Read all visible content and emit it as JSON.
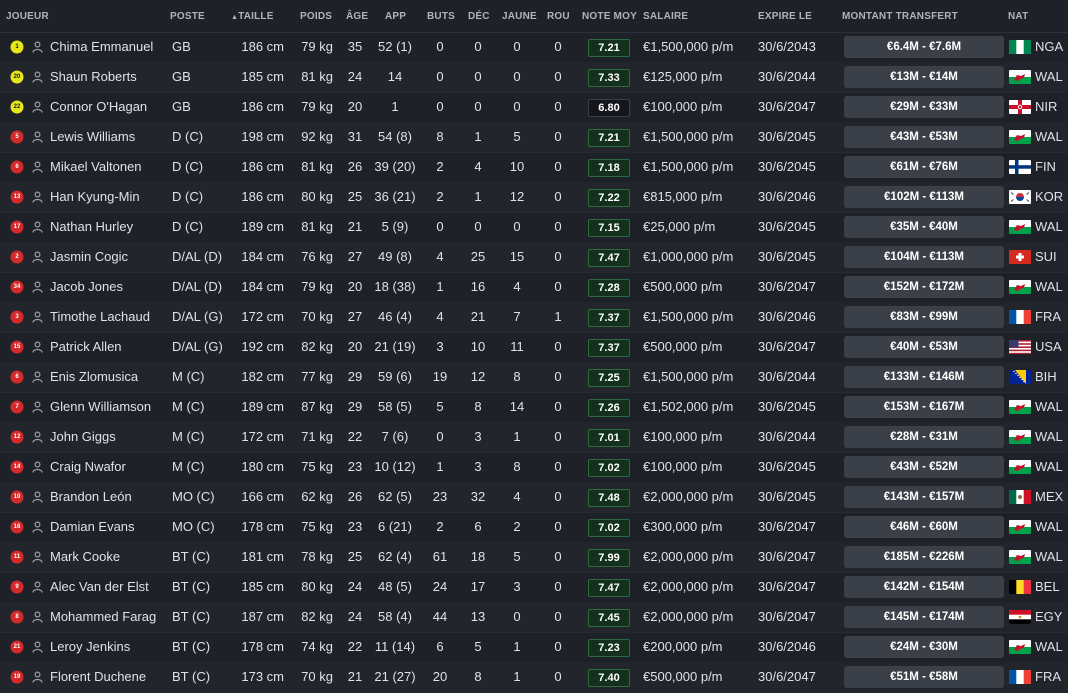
{
  "columns": {
    "player": "JOUEUR",
    "position": "POSTE",
    "height": "TAILLE",
    "weight": "POIDS",
    "age": "ÂGE",
    "apps": "APP",
    "goals": "BUTS",
    "dec": "DÉC",
    "yellow": "JAUNE",
    "red": "ROU",
    "avg_rating": "NOTE MOY",
    "wage": "SALAIRE",
    "expires": "EXPIRE LE",
    "transfer_value": "MONTANT TRANSFERT",
    "nat": "NAT"
  },
  "sort_indicator": "▲",
  "colors": {
    "background": "#1e2128",
    "row_alt": "#22252c",
    "rating_bg": "#12301c",
    "rating_border": "#2e6a3e",
    "value_pill": "#3a3f48",
    "gk_shirt": "#e6e619",
    "outfield_shirt": "#d42a2a"
  },
  "players": [
    {
      "num": "1",
      "shirt": "gk",
      "name": "Chima Emmanuel",
      "pos": "GB",
      "height": "186 cm",
      "weight": "79 kg",
      "age": "35",
      "apps": "52 (1)",
      "goals": "0",
      "dec": "0",
      "yellow": "0",
      "red": "0",
      "rating": "7.21",
      "wage": "€1,500,000 p/m",
      "expires": "30/6/2043",
      "value": "€6.4M - €7.6M",
      "flag": "nga",
      "nat": "NGA"
    },
    {
      "num": "20",
      "shirt": "gk",
      "name": "Shaun Roberts",
      "pos": "GB",
      "height": "185 cm",
      "weight": "81 kg",
      "age": "24",
      "apps": "14",
      "goals": "0",
      "dec": "0",
      "yellow": "0",
      "red": "0",
      "rating": "7.33",
      "wage": "€125,000 p/m",
      "expires": "30/6/2044",
      "value": "€13M - €14M",
      "flag": "wal",
      "nat": "WAL"
    },
    {
      "num": "22",
      "shirt": "gk",
      "name": "Connor O'Hagan",
      "pos": "GB",
      "height": "186 cm",
      "weight": "79 kg",
      "age": "20",
      "apps": "1",
      "goals": "0",
      "dec": "0",
      "yellow": "0",
      "red": "0",
      "rating": "6.80",
      "wage": "€100,000 p/m",
      "expires": "30/6/2047",
      "value": "€29M - €33M",
      "flag": "nir",
      "nat": "NIR"
    },
    {
      "num": "5",
      "shirt": "out",
      "name": "Lewis Williams",
      "pos": "D (C)",
      "height": "198 cm",
      "weight": "92 kg",
      "age": "31",
      "apps": "54 (8)",
      "goals": "8",
      "dec": "1",
      "yellow": "5",
      "red": "0",
      "rating": "7.21",
      "wage": "€1,500,000 p/m",
      "expires": "30/6/2045",
      "value": "€43M - €53M",
      "flag": "wal",
      "nat": "WAL"
    },
    {
      "num": "6",
      "shirt": "out",
      "name": "Mikael Valtonen",
      "pos": "D (C)",
      "height": "186 cm",
      "weight": "81 kg",
      "age": "26",
      "apps": "39 (20)",
      "goals": "2",
      "dec": "4",
      "yellow": "10",
      "red": "0",
      "rating": "7.18",
      "wage": "€1,500,000 p/m",
      "expires": "30/6/2045",
      "value": "€61M - €76M",
      "flag": "fin",
      "nat": "FIN"
    },
    {
      "num": "13",
      "shirt": "out",
      "name": "Han Kyung-Min",
      "pos": "D (C)",
      "height": "186 cm",
      "weight": "80 kg",
      "age": "25",
      "apps": "36 (21)",
      "goals": "2",
      "dec": "1",
      "yellow": "12",
      "red": "0",
      "rating": "7.22",
      "wage": "€815,000 p/m",
      "expires": "30/6/2046",
      "value": "€102M - €113M",
      "flag": "kor",
      "nat": "KOR"
    },
    {
      "num": "17",
      "shirt": "out",
      "name": "Nathan Hurley",
      "pos": "D (C)",
      "height": "189 cm",
      "weight": "81 kg",
      "age": "21",
      "apps": "5 (9)",
      "goals": "0",
      "dec": "0",
      "yellow": "0",
      "red": "0",
      "rating": "7.15",
      "wage": "€25,000 p/m",
      "expires": "30/6/2045",
      "value": "€35M - €40M",
      "flag": "wal",
      "nat": "WAL"
    },
    {
      "num": "2",
      "shirt": "out",
      "name": "Jasmin Cogic",
      "pos": "D/AL (D)",
      "height": "184 cm",
      "weight": "76 kg",
      "age": "27",
      "apps": "49 (8)",
      "goals": "4",
      "dec": "25",
      "yellow": "15",
      "red": "0",
      "rating": "7.47",
      "wage": "€1,000,000 p/m",
      "expires": "30/6/2045",
      "value": "€104M - €113M",
      "flag": "sui",
      "nat": "SUI"
    },
    {
      "num": "34",
      "shirt": "out",
      "name": "Jacob Jones",
      "pos": "D/AL (D)",
      "height": "184 cm",
      "weight": "79 kg",
      "age": "20",
      "apps": "18 (38)",
      "goals": "1",
      "dec": "16",
      "yellow": "4",
      "red": "0",
      "rating": "7.28",
      "wage": "€500,000 p/m",
      "expires": "30/6/2047",
      "value": "€152M - €172M",
      "flag": "wal",
      "nat": "WAL"
    },
    {
      "num": "3",
      "shirt": "out",
      "name": "Timothe Lachaud",
      "pos": "D/AL (G)",
      "height": "172 cm",
      "weight": "70 kg",
      "age": "27",
      "apps": "46 (4)",
      "goals": "4",
      "dec": "21",
      "yellow": "7",
      "red": "1",
      "rating": "7.37",
      "wage": "€1,500,000 p/m",
      "expires": "30/6/2046",
      "value": "€83M - €99M",
      "flag": "fra",
      "nat": "FRA"
    },
    {
      "num": "15",
      "shirt": "out",
      "name": "Patrick Allen",
      "pos": "D/AL (G)",
      "height": "192 cm",
      "weight": "82 kg",
      "age": "20",
      "apps": "21 (19)",
      "goals": "3",
      "dec": "10",
      "yellow": "11",
      "red": "0",
      "rating": "7.37",
      "wage": "€500,000 p/m",
      "expires": "30/6/2047",
      "value": "€40M - €53M",
      "flag": "usa",
      "nat": "USA"
    },
    {
      "num": "6",
      "shirt": "out",
      "name": "Enis Zlomusica",
      "pos": "M (C)",
      "height": "182 cm",
      "weight": "77 kg",
      "age": "29",
      "apps": "59 (6)",
      "goals": "19",
      "dec": "12",
      "yellow": "8",
      "red": "0",
      "rating": "7.25",
      "wage": "€1,500,000 p/m",
      "expires": "30/6/2044",
      "value": "€133M - €146M",
      "flag": "bih",
      "nat": "BIH"
    },
    {
      "num": "7",
      "shirt": "out",
      "name": "Glenn Williamson",
      "pos": "M (C)",
      "height": "189 cm",
      "weight": "87 kg",
      "age": "29",
      "apps": "58 (5)",
      "goals": "5",
      "dec": "8",
      "yellow": "14",
      "red": "0",
      "rating": "7.26",
      "wage": "€1,502,000 p/m",
      "expires": "30/6/2045",
      "value": "€153M - €167M",
      "flag": "wal",
      "nat": "WAL"
    },
    {
      "num": "12",
      "shirt": "out",
      "name": "John Giggs",
      "pos": "M (C)",
      "height": "172 cm",
      "weight": "71 kg",
      "age": "22",
      "apps": "7 (6)",
      "goals": "0",
      "dec": "3",
      "yellow": "1",
      "red": "0",
      "rating": "7.01",
      "wage": "€100,000 p/m",
      "expires": "30/6/2044",
      "value": "€28M - €31M",
      "flag": "wal",
      "nat": "WAL"
    },
    {
      "num": "14",
      "shirt": "out",
      "name": "Craig Nwafor",
      "pos": "M (C)",
      "height": "180 cm",
      "weight": "75 kg",
      "age": "23",
      "apps": "10 (12)",
      "goals": "1",
      "dec": "3",
      "yellow": "8",
      "red": "0",
      "rating": "7.02",
      "wage": "€100,000 p/m",
      "expires": "30/6/2045",
      "value": "€43M - €52M",
      "flag": "wal",
      "nat": "WAL"
    },
    {
      "num": "10",
      "shirt": "out",
      "name": "Brandon León",
      "pos": "MO (C)",
      "height": "166 cm",
      "weight": "62 kg",
      "age": "26",
      "apps": "62 (5)",
      "goals": "23",
      "dec": "32",
      "yellow": "4",
      "red": "0",
      "rating": "7.48",
      "wage": "€2,000,000 p/m",
      "expires": "30/6/2045",
      "value": "€143M - €157M",
      "flag": "mex",
      "nat": "MEX"
    },
    {
      "num": "16",
      "shirt": "out",
      "name": "Damian Evans",
      "pos": "MO (C)",
      "height": "178 cm",
      "weight": "75 kg",
      "age": "23",
      "apps": "6 (21)",
      "goals": "2",
      "dec": "6",
      "yellow": "2",
      "red": "0",
      "rating": "7.02",
      "wage": "€300,000 p/m",
      "expires": "30/6/2047",
      "value": "€46M - €60M",
      "flag": "wal",
      "nat": "WAL"
    },
    {
      "num": "11",
      "shirt": "out",
      "name": "Mark Cooke",
      "pos": "BT (C)",
      "height": "181 cm",
      "weight": "78 kg",
      "age": "25",
      "apps": "62 (4)",
      "goals": "61",
      "dec": "18",
      "yellow": "5",
      "red": "0",
      "rating": "7.99",
      "wage": "€2,000,000 p/m",
      "expires": "30/6/2047",
      "value": "€185M - €226M",
      "flag": "wal",
      "nat": "WAL"
    },
    {
      "num": "9",
      "shirt": "out",
      "name": "Alec Van der Elst",
      "pos": "BT (C)",
      "height": "185 cm",
      "weight": "80 kg",
      "age": "24",
      "apps": "48 (5)",
      "goals": "24",
      "dec": "17",
      "yellow": "3",
      "red": "0",
      "rating": "7.47",
      "wage": "€2,000,000 p/m",
      "expires": "30/6/2047",
      "value": "€142M - €154M",
      "flag": "bel",
      "nat": "BEL"
    },
    {
      "num": "8",
      "shirt": "out",
      "name": "Mohammed Farag",
      "pos": "BT (C)",
      "height": "187 cm",
      "weight": "82 kg",
      "age": "24",
      "apps": "58 (4)",
      "goals": "44",
      "dec": "13",
      "yellow": "0",
      "red": "0",
      "rating": "7.45",
      "wage": "€2,000,000 p/m",
      "expires": "30/6/2047",
      "value": "€145M - €174M",
      "flag": "egy",
      "nat": "EGY"
    },
    {
      "num": "21",
      "shirt": "out",
      "name": "Leroy Jenkins",
      "pos": "BT (C)",
      "height": "178 cm",
      "weight": "74 kg",
      "age": "22",
      "apps": "11 (14)",
      "goals": "6",
      "dec": "5",
      "yellow": "1",
      "red": "0",
      "rating": "7.23",
      "wage": "€200,000 p/m",
      "expires": "30/6/2046",
      "value": "€24M - €30M",
      "flag": "wal",
      "nat": "WAL"
    },
    {
      "num": "19",
      "shirt": "out",
      "name": "Florent Duchene",
      "pos": "BT (C)",
      "height": "173 cm",
      "weight": "70 kg",
      "age": "21",
      "apps": "21 (27)",
      "goals": "20",
      "dec": "8",
      "yellow": "1",
      "red": "0",
      "rating": "7.40",
      "wage": "€500,000 p/m",
      "expires": "30/6/2047",
      "value": "€51M - €58M",
      "flag": "fra",
      "nat": "FRA"
    }
  ]
}
